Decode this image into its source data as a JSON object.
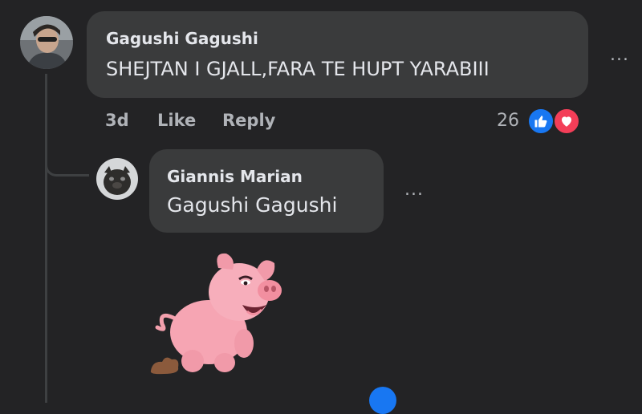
{
  "comment": {
    "author": "Gagushi Gagushi",
    "text": "SHEJTAN I GJALL,FARA TE HUPT YARABIII",
    "more_label": "...",
    "age": "3d",
    "like_label": "Like",
    "reply_label": "Reply",
    "reaction_count": "26",
    "reactions": [
      "like-icon",
      "love-icon"
    ],
    "colors": {
      "like": "#1877f2",
      "love": "#f33e58"
    }
  },
  "reply": {
    "author": "Giannis Marian",
    "text": "Gagushi Gagushi",
    "more_label": "...",
    "sticker": "pig-sticker"
  }
}
